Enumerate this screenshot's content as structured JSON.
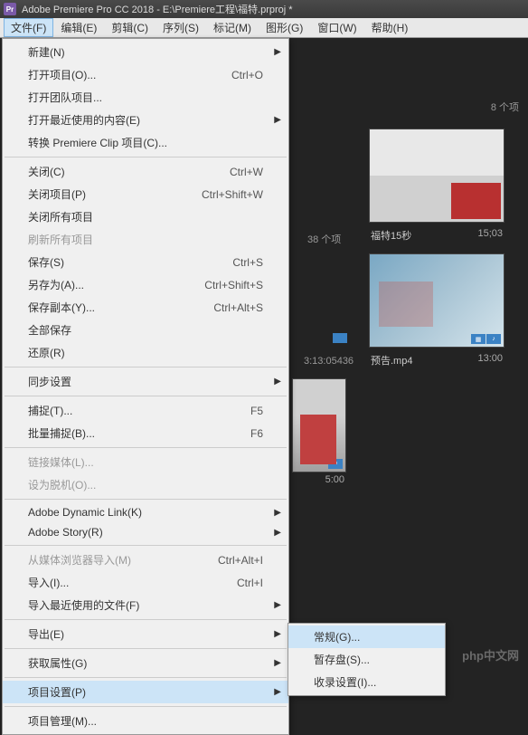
{
  "titlebar": {
    "icon_text": "Pr",
    "title": "Adobe Premiere Pro CC 2018 - E:\\Premiere工程\\福特.prproj *"
  },
  "menubar": {
    "items": [
      "文件(F)",
      "编辑(E)",
      "剪辑(C)",
      "序列(S)",
      "标记(M)",
      "图形(G)",
      "窗口(W)",
      "帮助(H)"
    ]
  },
  "file_menu": {
    "groups": [
      [
        {
          "label": "新建(N)",
          "submenu": true
        },
        {
          "label": "打开项目(O)...",
          "shortcut": "Ctrl+O"
        },
        {
          "label": "打开团队项目..."
        },
        {
          "label": "打开最近使用的内容(E)",
          "submenu": true
        },
        {
          "label": "转换 Premiere Clip 项目(C)..."
        }
      ],
      [
        {
          "label": "关闭(C)",
          "shortcut": "Ctrl+W"
        },
        {
          "label": "关闭项目(P)",
          "shortcut": "Ctrl+Shift+W"
        },
        {
          "label": "关闭所有项目"
        },
        {
          "label": "刷新所有项目",
          "disabled": true
        },
        {
          "label": "保存(S)",
          "shortcut": "Ctrl+S"
        },
        {
          "label": "另存为(A)...",
          "shortcut": "Ctrl+Shift+S"
        },
        {
          "label": "保存副本(Y)...",
          "shortcut": "Ctrl+Alt+S"
        },
        {
          "label": "全部保存"
        },
        {
          "label": "还原(R)"
        }
      ],
      [
        {
          "label": "同步设置",
          "submenu": true
        }
      ],
      [
        {
          "label": "捕捉(T)...",
          "shortcut": "F5"
        },
        {
          "label": "批量捕捉(B)...",
          "shortcut": "F6"
        }
      ],
      [
        {
          "label": "链接媒体(L)...",
          "disabled": true
        },
        {
          "label": "设为脱机(O)...",
          "disabled": true
        }
      ],
      [
        {
          "label": "Adobe Dynamic Link(K)",
          "submenu": true
        },
        {
          "label": "Adobe Story(R)",
          "submenu": true
        }
      ],
      [
        {
          "label": "从媒体浏览器导入(M)",
          "shortcut": "Ctrl+Alt+I",
          "disabled": true
        },
        {
          "label": "导入(I)...",
          "shortcut": "Ctrl+I"
        },
        {
          "label": "导入最近使用的文件(F)",
          "submenu": true
        }
      ],
      [
        {
          "label": "导出(E)",
          "submenu": true
        }
      ],
      [
        {
          "label": "获取属性(G)",
          "submenu": true
        }
      ],
      [
        {
          "label": "项目设置(P)",
          "submenu": true,
          "hover": true
        }
      ],
      [
        {
          "label": "项目管理(M)..."
        }
      ]
    ]
  },
  "project_settings_submenu": {
    "items": [
      {
        "label": "常规(G)...",
        "hover": true
      },
      {
        "label": "暂存盘(S)..."
      },
      {
        "label": "收录设置(I)..."
      }
    ]
  },
  "content": {
    "top_count": "8 个项",
    "mid_count": "38 个项",
    "thumbs": [
      {
        "label": "福特15秒",
        "duration": "15;03"
      },
      {
        "label": "预告.mp4",
        "duration": "13:00"
      }
    ],
    "tc1": "3:13:05436",
    "thumb3_dur": "5:00"
  },
  "watermark": "php中文网"
}
